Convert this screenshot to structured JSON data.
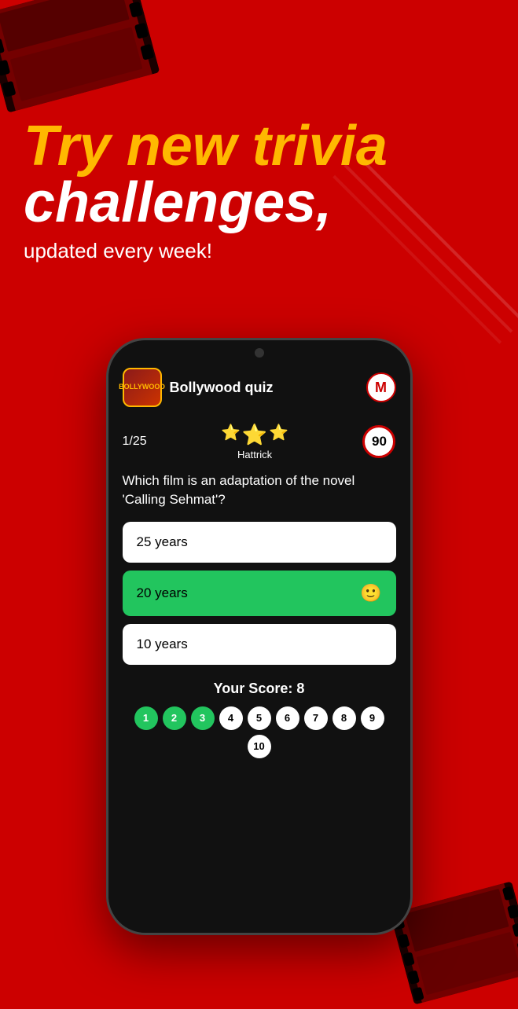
{
  "background": {
    "color": "#cc0000"
  },
  "hero": {
    "line1": "Try new trivia",
    "line2": "challenges,",
    "subtitle": "updated every week!"
  },
  "app": {
    "logo_text": "BOLLYWOOD",
    "title": "Bollywood quiz",
    "avatar_initial": "M"
  },
  "quiz": {
    "question_number": "1/25",
    "hattrick_label": "Hattrick",
    "timer_value": "90",
    "question_text": "Which film is an adaptation of the novel 'Calling Sehmat'?",
    "answers": [
      {
        "text": "25 years",
        "style": "white",
        "emoji": null
      },
      {
        "text": "20 years",
        "style": "green",
        "emoji": "🙂"
      },
      {
        "text": "10 years",
        "style": "white",
        "emoji": null
      }
    ]
  },
  "score": {
    "label": "Your Score: 8"
  },
  "progress": [
    {
      "num": "1",
      "state": "green"
    },
    {
      "num": "2",
      "state": "green"
    },
    {
      "num": "3",
      "state": "green"
    },
    {
      "num": "4",
      "state": "white"
    },
    {
      "num": "5",
      "state": "white"
    },
    {
      "num": "6",
      "state": "white"
    },
    {
      "num": "7",
      "state": "white"
    },
    {
      "num": "8",
      "state": "white"
    },
    {
      "num": "9",
      "state": "white"
    },
    {
      "num": "10",
      "state": "white"
    }
  ]
}
